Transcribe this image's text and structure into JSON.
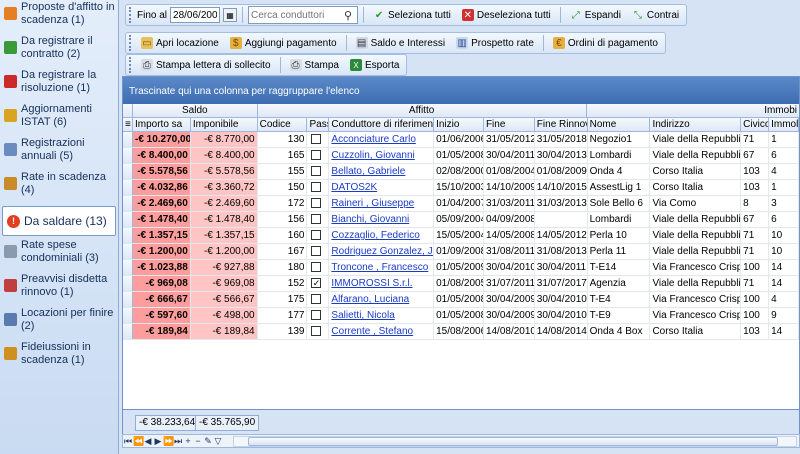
{
  "sidebar": {
    "items": [
      {
        "label": "Proposte d'affitto in scadenza (1)",
        "icon": "document-icon",
        "color": "#e67e22"
      },
      {
        "label": "Da registrare il contratto (2)",
        "icon": "plus-icon",
        "color": "#3a9a3a"
      },
      {
        "label": "Da registrare la risoluzione (1)",
        "icon": "cancel-document-icon",
        "color": "#cc2a2a"
      },
      {
        "label": "Aggiornamenti ISTAT (6)",
        "icon": "chart-icon",
        "color": "#d9a520"
      },
      {
        "label": "Registrazioni annuali (5)",
        "icon": "stamp-icon",
        "color": "#6a8cc0"
      },
      {
        "label": "Rate in scadenza (4)",
        "icon": "money-bag-icon",
        "color": "#c98a2a"
      },
      {
        "label": "Da saldare (13)",
        "icon": "alert-icon",
        "color": "#e04020",
        "active": true
      },
      {
        "label": "Rate spese condominiali (3)",
        "icon": "building-icon",
        "color": "#8a9bb0"
      },
      {
        "label": "Preavvisi disdetta rinnovo (1)",
        "icon": "notice-icon",
        "color": "#c04040"
      },
      {
        "label": "Locazioni per finire (2)",
        "icon": "calendar-icon",
        "color": "#5a7ab0"
      },
      {
        "label": "Fideiussioni in scadenza (1)",
        "icon": "coin-icon",
        "color": "#d09020"
      }
    ]
  },
  "toolbar1": {
    "date_label": "Fino al",
    "date_value": "28/06/2009",
    "search_placeholder": "Cerca conduttori",
    "select_all": "Seleziona tutti",
    "deselect_all": "Deseleziona tutti",
    "expand": "Espandi",
    "collapse": "Contrai"
  },
  "toolbar2": {
    "open_lease": "Apri locazione",
    "add_payment": "Aggiungi pagamento",
    "balance_interest": "Saldo e Interessi",
    "rate_schedule": "Prospetto rate",
    "payment_orders": "Ordini di pagamento"
  },
  "toolbar3": {
    "print_reminder": "Stampa lettera di sollecito",
    "print": "Stampa",
    "export": "Esporta"
  },
  "grid": {
    "group_hint": "Trascinate qui una colonna per raggruppare l'elenco",
    "bands": {
      "saldo": "Saldo",
      "affitto": "Affitto",
      "immobile": "Immobi"
    },
    "headers": [
      "Importo sa",
      "Imponibile",
      "Codice",
      "Pass",
      "Conduttore di riferimento",
      "Inizio",
      "Fine",
      "Fine Rinnov",
      "Nome",
      "Indirizzo",
      "Civico",
      "Immol"
    ],
    "rows": [
      {
        "importo": "-€ 10.270,00",
        "imponibile": "-€ 8.770,00",
        "codice": "130",
        "pass": false,
        "conduttore": "Acconciature Carlo",
        "inizio": "01/06/2006",
        "fine": "31/05/2012",
        "fine_rinnovo": "31/05/2018",
        "nome": "Negozio1",
        "indirizzo": "Viale della Repubblica",
        "civico": "71",
        "immobile": "1"
      },
      {
        "importo": "-€ 8.400,00",
        "imponibile": "-€ 8.400,00",
        "codice": "165",
        "pass": false,
        "conduttore": "Cuzzolin, Giovanni",
        "inizio": "01/05/2008",
        "fine": "30/04/2011",
        "fine_rinnovo": "30/04/2013",
        "nome": "Lombardi",
        "indirizzo": "Viale della Repubblica",
        "civico": "67",
        "immobile": "6"
      },
      {
        "importo": "-€ 5.578,56",
        "imponibile": "-€ 5.578,56",
        "codice": "155",
        "pass": false,
        "conduttore": "Bellato, Gabriele",
        "inizio": "02/08/2000",
        "fine": "01/08/2004",
        "fine_rinnovo": "01/08/2009",
        "nome": "Onda 4",
        "indirizzo": "Corso Italia",
        "civico": "103",
        "immobile": "4"
      },
      {
        "importo": "-€ 4.032,86",
        "imponibile": "-€ 3.360,72",
        "codice": "150",
        "pass": false,
        "conduttore": "DATOS2K",
        "inizio": "15/10/2003",
        "fine": "14/10/2009",
        "fine_rinnovo": "14/10/2015",
        "nome": "AssestLig 1",
        "indirizzo": "Corso Italia",
        "civico": "103",
        "immobile": "1"
      },
      {
        "importo": "-€ 2.469,60",
        "imponibile": "-€ 2.469,60",
        "codice": "172",
        "pass": false,
        "conduttore": "Raineri , Giuseppe",
        "inizio": "01/04/2007",
        "fine": "31/03/2011",
        "fine_rinnovo": "31/03/2013",
        "nome": "Sole Bello 6",
        "indirizzo": "Via Como",
        "civico": "8",
        "immobile": "3"
      },
      {
        "importo": "-€ 1.478,40",
        "imponibile": "-€ 1.478,40",
        "codice": "156",
        "pass": false,
        "conduttore": "Bianchi, Giovanni",
        "inizio": "05/09/2004",
        "fine": "04/09/2008",
        "fine_rinnovo": "",
        "nome": "Lombardi",
        "indirizzo": "Viale della Repubblica",
        "civico": "67",
        "immobile": "6"
      },
      {
        "importo": "-€ 1.357,15",
        "imponibile": "-€ 1.357,15",
        "codice": "160",
        "pass": false,
        "conduttore": "Cozzaglio, Federico",
        "inizio": "15/05/2004",
        "fine": "14/05/2008",
        "fine_rinnovo": "14/05/2012",
        "nome": "Perla 10",
        "indirizzo": "Viale della Repubblica",
        "civico": "71",
        "immobile": "10"
      },
      {
        "importo": "-€ 1.200,00",
        "imponibile": "-€ 1.200,00",
        "codice": "167",
        "pass": false,
        "conduttore": "Rodriguez Gonzalez, Julio",
        "inizio": "01/09/2008",
        "fine": "31/08/2011",
        "fine_rinnovo": "31/08/2013",
        "nome": "Perla 11",
        "indirizzo": "Viale della Repubblica",
        "civico": "71",
        "immobile": "10"
      },
      {
        "importo": "-€ 1.023,88",
        "imponibile": "-€ 927,88",
        "codice": "180",
        "pass": false,
        "conduttore": "Troncone , Francesco",
        "inizio": "01/05/2009",
        "fine": "30/04/2010",
        "fine_rinnovo": "30/04/2011",
        "nome": "T-E14",
        "indirizzo": "Via Francesco Crispi",
        "civico": "100",
        "immobile": "14"
      },
      {
        "importo": "-€ 969,08",
        "imponibile": "-€ 969,08",
        "codice": "152",
        "pass": true,
        "conduttore": "IMMOROSSI S.r.l.",
        "inizio": "01/08/2005",
        "fine": "31/07/2011",
        "fine_rinnovo": "31/07/2017",
        "nome": "Agenzia",
        "indirizzo": "Viale della Repubblica",
        "civico": "71",
        "immobile": "14"
      },
      {
        "importo": "-€ 666,67",
        "imponibile": "-€ 566,67",
        "codice": "175",
        "pass": false,
        "conduttore": "Alfarano, Luciana",
        "inizio": "01/05/2008",
        "fine": "30/04/2009",
        "fine_rinnovo": "30/04/2010",
        "nome": "T-E4",
        "indirizzo": "Via Francesco Crispi",
        "civico": "100",
        "immobile": "4"
      },
      {
        "importo": "-€ 597,60",
        "imponibile": "-€ 498,00",
        "codice": "177",
        "pass": false,
        "conduttore": "Salietti, Nicola",
        "inizio": "01/05/2008",
        "fine": "30/04/2009",
        "fine_rinnovo": "30/04/2010",
        "nome": "T-E9",
        "indirizzo": "Via Francesco Crispi",
        "civico": "100",
        "immobile": "9"
      },
      {
        "importo": "-€ 189,84",
        "imponibile": "-€ 189,84",
        "codice": "139",
        "pass": false,
        "conduttore": "Corrente , Stefano",
        "inizio": "15/08/2006",
        "fine": "14/08/2010",
        "fine_rinnovo": "14/08/2014",
        "nome": "Onda 4 Box",
        "indirizzo": "Corso Italia",
        "civico": "103",
        "immobile": "14"
      }
    ]
  },
  "footer": {
    "total_importo": "-€ 38.233,64",
    "total_imponibile": "-€ 35.765,90"
  },
  "colors": {
    "importo_bg": "#ff9d9d",
    "imponibile_bg": "#ffc4c4",
    "group_area": "#4a7abd",
    "link": "#1a3bc8"
  }
}
